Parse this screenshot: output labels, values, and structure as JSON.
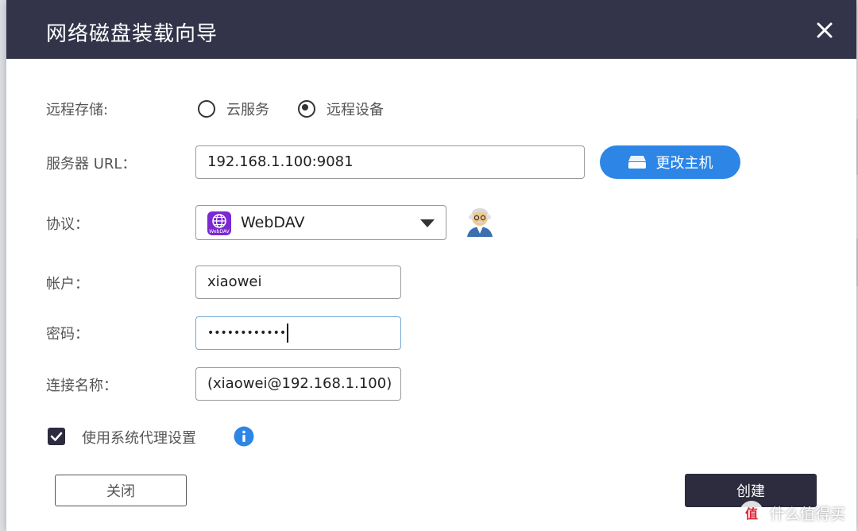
{
  "dialog": {
    "title": "网络磁盘装载向导",
    "close_icon": "close-icon"
  },
  "form": {
    "remote_storage": {
      "label": "远程存储:",
      "options": [
        {
          "label": "云服务",
          "checked": false
        },
        {
          "label": "远程设备",
          "checked": true
        }
      ]
    },
    "server_url": {
      "label": "服务器 URL：",
      "value": "192.168.1.100:9081",
      "change_host_label": "更改主机",
      "change_host_icon": "server-icon"
    },
    "protocol": {
      "label": "协议：",
      "selected": "WebDAV",
      "icon": "webdav-icon",
      "icon_caption": "WebDAV",
      "assistant_icon": "assistant-avatar-icon"
    },
    "account": {
      "label": "帐户：",
      "value": "xiaowei"
    },
    "password": {
      "label": "密码：",
      "value": "••••••••••••"
    },
    "connection_name": {
      "label": "连接名称：",
      "value": "(xiaowei@192.168.1.100)"
    },
    "proxy": {
      "label": "使用系统代理设置",
      "checked": true,
      "info_icon": "info-icon"
    }
  },
  "buttons": {
    "close_label": "关闭",
    "create_label": "创建"
  },
  "watermark": {
    "logo_text": "值",
    "text": "什么值得买"
  },
  "colors": {
    "titlebar": "#33334a",
    "accent_blue": "#2d86e6",
    "primary_dark": "#2c2c3e",
    "webdav_purple": "#7a2ad0"
  }
}
